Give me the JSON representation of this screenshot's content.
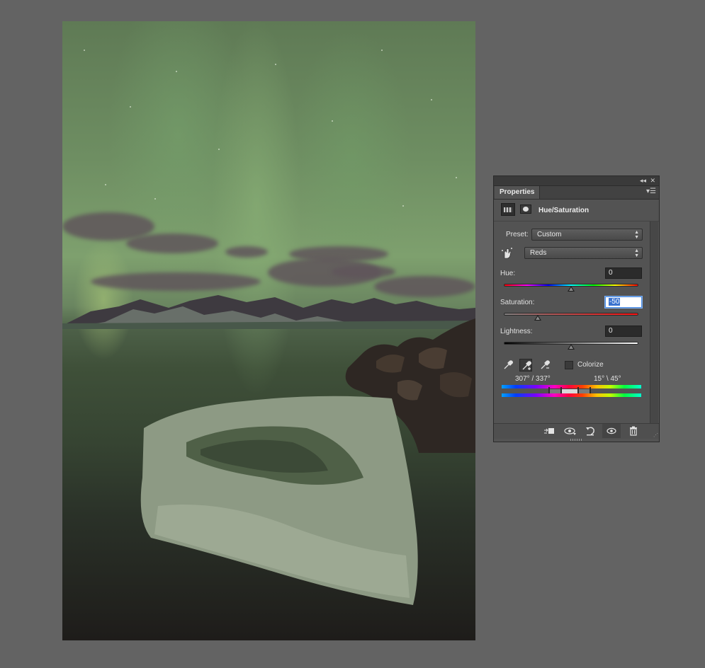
{
  "panel": {
    "tab_label": "Properties",
    "title": "Hue/Saturation",
    "preset_label": "Preset:",
    "preset_value": "Custom",
    "channel_value": "Reds",
    "hue_label": "Hue:",
    "hue_value": "0",
    "saturation_label": "Saturation:",
    "saturation_value": "-50",
    "lightness_label": "Lightness:",
    "lightness_value": "0",
    "colorize_label": "Colorize",
    "range_left": "307° / 337°",
    "range_right": "15° \\ 45°"
  },
  "icons": {
    "collapse": "double-chevron-left-icon",
    "close": "close-icon",
    "panel_menu": "panel-menu-icon",
    "adjustment": "hue-saturation-adjustment-icon",
    "mask": "layer-mask-icon",
    "targeted_adjust": "targeted-adjustment-hand-icon",
    "eyedropper": "eyedropper-icon",
    "eyedropper_add": "eyedropper-plus-icon",
    "eyedropper_subtract": "eyedropper-minus-icon",
    "clip": "clip-to-layer-icon",
    "view_previous": "view-previous-state-icon",
    "reset": "reset-icon",
    "visibility": "eye-icon",
    "delete": "trash-icon"
  },
  "colors": {
    "workspace": "#636363",
    "panel_bg": "#535353",
    "field_focus": "#3b73d0"
  }
}
